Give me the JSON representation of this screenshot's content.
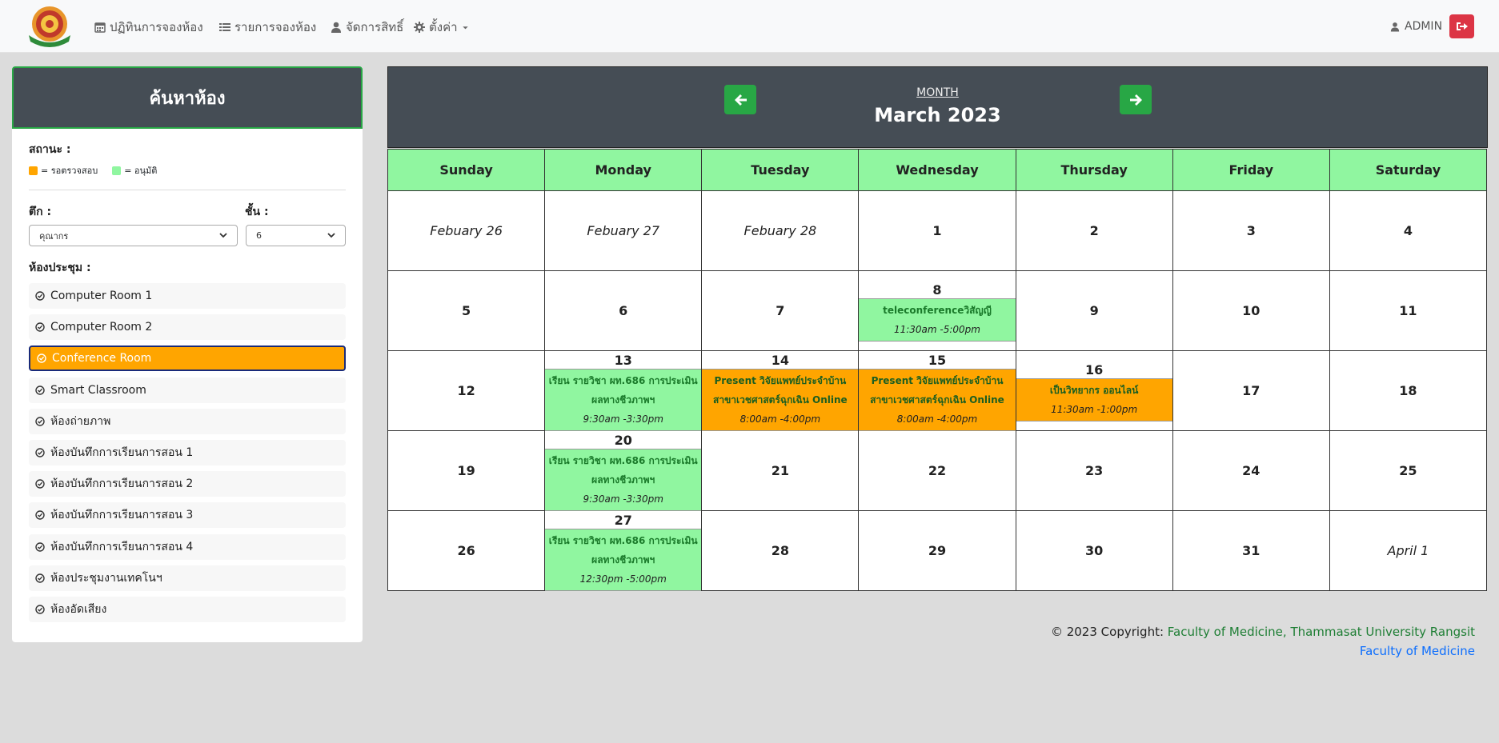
{
  "nav": {
    "items": [
      {
        "label": "ปฏิทินการจองห้อง",
        "icon": "calendar-icon"
      },
      {
        "label": "รายการจองห้อง",
        "icon": "list-icon"
      },
      {
        "label": "จัดการสิทธิ์",
        "icon": "user-icon"
      },
      {
        "label": "ตั้งค่า",
        "icon": "gear-icon"
      }
    ],
    "user": "ADMIN"
  },
  "sidebar": {
    "title": "ค้นหาห้อง",
    "status_label": "สถานะ :",
    "legend": [
      {
        "color": "#ffa500",
        "label": "= รอตรวจสอบ"
      },
      {
        "color": "#90f6a0",
        "label": "= อนุมัติ"
      }
    ],
    "building_label": "ตึก :",
    "building_value": "คุณากร",
    "floor_label": "ชั้น :",
    "floor_value": "6",
    "rooms_label": "ห้องประชุม :",
    "rooms": [
      "Computer Room 1",
      "Computer Room 2",
      "Conference Room",
      "Smart Classroom",
      "ห้องถ่ายภาพ",
      "ห้องบันทึกการเรียนการสอน 1",
      "ห้องบันทึกการเรียนการสอน 2",
      "ห้องบันทึกการเรียนการสอน 3",
      "ห้องบันทึกการเรียนการสอน 4",
      "ห้องประชุมงานเทคโนฯ",
      "ห้องอัดเสียง"
    ],
    "active_room": "Conference Room"
  },
  "calendar": {
    "view_label": "MONTH",
    "title": "March 2023",
    "weekdays": [
      "Sunday",
      "Monday",
      "Tuesday",
      "Wednesday",
      "Thursday",
      "Friday",
      "Saturday"
    ],
    "weeks": [
      [
        {
          "label": "Febuary 26",
          "other": true
        },
        {
          "label": "Febuary 27",
          "other": true
        },
        {
          "label": "Febuary 28",
          "other": true
        },
        {
          "label": "1"
        },
        {
          "label": "2"
        },
        {
          "label": "3"
        },
        {
          "label": "4"
        }
      ],
      [
        {
          "label": "5"
        },
        {
          "label": "6"
        },
        {
          "label": "7"
        },
        {
          "label": "8",
          "events": [
            {
              "title": "teleconferenceวิสัญญี",
              "time": "11:30am -5:00pm",
              "status": "green"
            }
          ]
        },
        {
          "label": "9"
        },
        {
          "label": "10"
        },
        {
          "label": "11"
        }
      ],
      [
        {
          "label": "12"
        },
        {
          "label": "13",
          "events": [
            {
              "title": "เรียน รายวิชา ผท.686 การประเมินผลทางชีวภาพฯ",
              "time": "9:30am -3:30pm",
              "status": "green"
            }
          ]
        },
        {
          "label": "14",
          "events": [
            {
              "title": "Present วิจัยแพทย์ประจำบ้าน สาขาเวชศาสตร์ฉุกเฉิน Online",
              "time": "8:00am -4:00pm",
              "status": "orange"
            }
          ]
        },
        {
          "label": "15",
          "events": [
            {
              "title": "Present วิจัยแพทย์ประจำบ้าน สาขาเวชศาสตร์ฉุกเฉิน Online",
              "time": "8:00am -4:00pm",
              "status": "orange"
            }
          ]
        },
        {
          "label": "16",
          "events": [
            {
              "title": "เป็นวิทยากร ออนไลน์",
              "time": "11:30am -1:00pm",
              "status": "orange"
            }
          ]
        },
        {
          "label": "17"
        },
        {
          "label": "18"
        }
      ],
      [
        {
          "label": "19"
        },
        {
          "label": "20",
          "events": [
            {
              "title": "เรียน รายวิชา ผท.686 การประเมินผลทางชีวภาพฯ",
              "time": "9:30am -3:30pm",
              "status": "green"
            }
          ]
        },
        {
          "label": "21"
        },
        {
          "label": "22"
        },
        {
          "label": "23"
        },
        {
          "label": "24"
        },
        {
          "label": "25"
        }
      ],
      [
        {
          "label": "26"
        },
        {
          "label": "27",
          "events": [
            {
              "title": "เรียน รายวิชา ผท.686 การประเมินผลทางชีวภาพฯ",
              "time": "12:30pm -5:00pm",
              "status": "green"
            }
          ]
        },
        {
          "label": "28"
        },
        {
          "label": "29"
        },
        {
          "label": "30"
        },
        {
          "label": "31"
        },
        {
          "label": "April 1",
          "other": true
        }
      ]
    ]
  },
  "footer": {
    "copyright": "© 2023 Copyright: ",
    "org": "Faculty of Medicine, Thammasat University Rangsit",
    "link": "Faculty of Medicine"
  }
}
